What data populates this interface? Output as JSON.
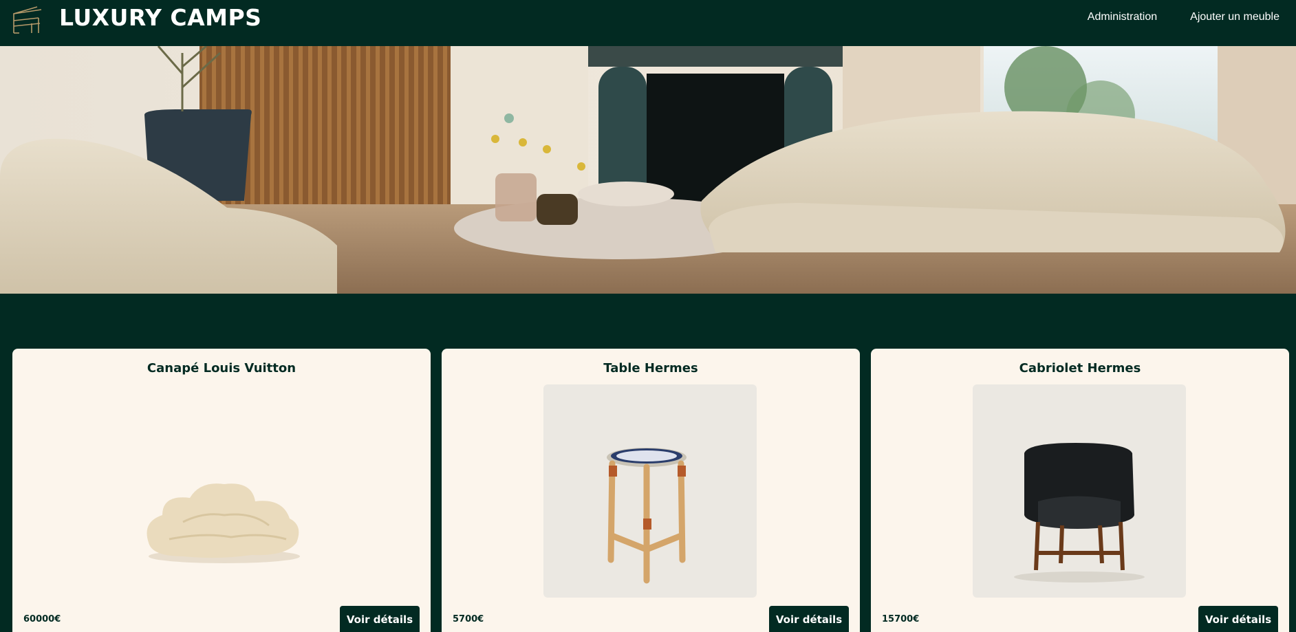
{
  "header": {
    "brand": "LUXURY CAMPS",
    "logo_icon": "chair-outline-icon",
    "nav": [
      {
        "label": "Administration"
      },
      {
        "label": "Ajouter un meuble"
      }
    ]
  },
  "hero": {
    "image": "living-room-banner-image",
    "description": "living room with cream sofas, marble coffee tables, fireplace"
  },
  "products": [
    {
      "name": "Canapé Louis Vuitton",
      "price": "60000€",
      "button_label": "Voir détails",
      "image": "cloud-sofa-image"
    },
    {
      "name": "Table Hermes",
      "price": "5700€",
      "button_label": "Voir détails",
      "image": "side-table-image"
    },
    {
      "name": "Cabriolet Hermes",
      "price": "15700€",
      "button_label": "Voir détails",
      "image": "black-armchair-image"
    }
  ],
  "colors": {
    "background": "#022a22",
    "card_background": "#fcf5ec",
    "text_dark": "#022a22",
    "text_light": "#ffffff",
    "accent_gold": "#b79a6a"
  }
}
